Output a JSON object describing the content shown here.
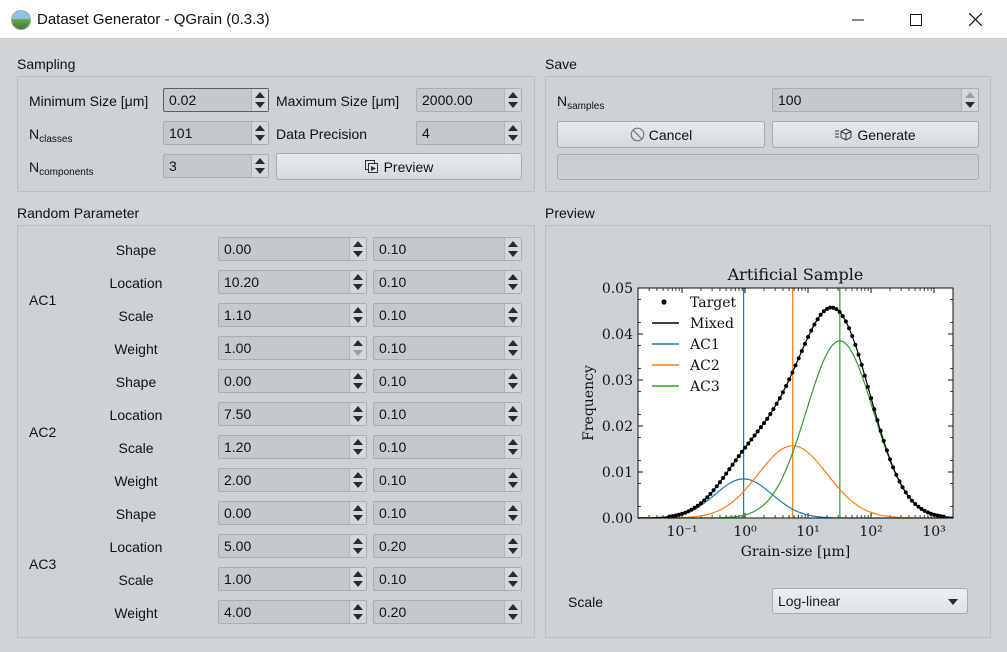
{
  "window": {
    "title": "Dataset Generator - QGrain (0.3.3)"
  },
  "sampling": {
    "title": "Sampling",
    "min_size_label": "Minimum Size [μm]",
    "min_size_value": "0.02",
    "max_size_label": "Maximum Size [μm]",
    "max_size_value": "2000.00",
    "n_classes_label": "N",
    "n_classes_sub": "classes",
    "n_classes_value": "101",
    "precision_label": "Data Precision",
    "precision_value": "4",
    "n_components_label": "N",
    "n_components_sub": "components",
    "n_components_value": "3",
    "preview_button": "Preview"
  },
  "save": {
    "title": "Save",
    "n_samples_label": "N",
    "n_samples_sub": "samples",
    "n_samples_value": "100",
    "cancel_button": "Cancel",
    "generate_button": "Generate"
  },
  "random_parameter": {
    "title": "Random Parameter",
    "components": [
      {
        "name": "AC1",
        "params": [
          {
            "label": "Shape",
            "mean": "0.00",
            "std": "0.10"
          },
          {
            "label": "Location",
            "mean": "10.20",
            "std": "0.10"
          },
          {
            "label": "Scale",
            "mean": "1.10",
            "std": "0.10"
          },
          {
            "label": "Weight",
            "mean": "1.00",
            "std": "0.10"
          }
        ]
      },
      {
        "name": "AC2",
        "params": [
          {
            "label": "Shape",
            "mean": "0.00",
            "std": "0.10"
          },
          {
            "label": "Location",
            "mean": "7.50",
            "std": "0.10"
          },
          {
            "label": "Scale",
            "mean": "1.20",
            "std": "0.10"
          },
          {
            "label": "Weight",
            "mean": "2.00",
            "std": "0.10"
          }
        ]
      },
      {
        "name": "AC3",
        "params": [
          {
            "label": "Shape",
            "mean": "0.00",
            "std": "0.10"
          },
          {
            "label": "Location",
            "mean": "5.00",
            "std": "0.20"
          },
          {
            "label": "Scale",
            "mean": "1.00",
            "std": "0.10"
          },
          {
            "label": "Weight",
            "mean": "4.00",
            "std": "0.20"
          }
        ]
      }
    ]
  },
  "preview": {
    "title": "Preview",
    "scale_label": "Scale",
    "scale_value": "Log-linear"
  },
  "chart_data": {
    "type": "line",
    "title": "Artificial Sample",
    "xlabel": "Grain-size [μm]",
    "ylabel": "Frequency",
    "xscale": "log",
    "xlim": [
      0.02,
      2000
    ],
    "ylim": [
      0,
      0.05
    ],
    "yticks": [
      "0.00",
      "0.01",
      "0.02",
      "0.03",
      "0.04",
      "0.05"
    ],
    "xticks": [
      "10⁻¹",
      "10⁰",
      "10¹",
      "10²",
      "10³"
    ],
    "legend": {
      "placement": "top-left",
      "entries": [
        "Target",
        "Mixed",
        "AC1",
        "AC2",
        "AC3"
      ]
    },
    "colors": {
      "Target": "#000000",
      "Mixed": "#000000",
      "AC1": "#1f77b4",
      "AC2": "#ff7f0e",
      "AC3": "#2ca02c"
    },
    "components": [
      {
        "name": "AC1",
        "peak_x": 0.95,
        "peak_y": 0.0085,
        "log_sigma": 0.45
      },
      {
        "name": "AC2",
        "peak_x": 5.7,
        "peak_y": 0.0157,
        "log_sigma": 0.55
      },
      {
        "name": "AC3",
        "peak_x": 32,
        "peak_y": 0.0385,
        "log_sigma": 0.53
      }
    ],
    "vlines": [
      0.95,
      5.7,
      32
    ]
  }
}
